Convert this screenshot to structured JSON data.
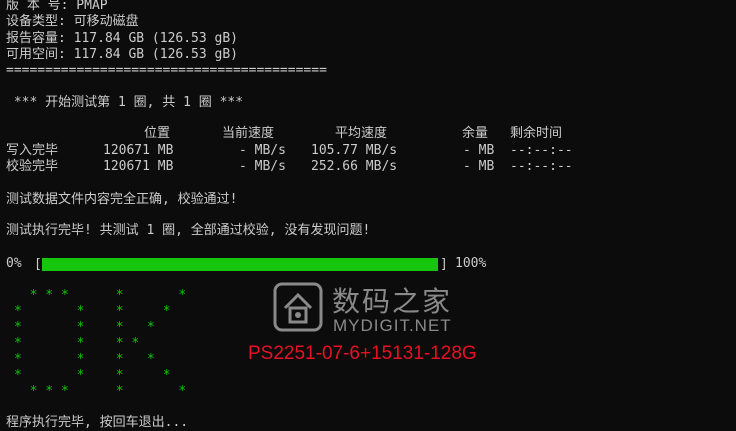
{
  "info": {
    "version_line": "版 本 号: PMAP",
    "device_type_line": "设备类型: 可移动磁盘",
    "reported_capacity_line": "报告容量: 117.84 GB (126.53 gB)",
    "available_space_line": "可用空间: 117.84 GB (126.53 gB)",
    "separator": "========================================="
  },
  "test": {
    "round_header": " *** 开始测试第 1 圈, 共 1 圈 ***"
  },
  "table": {
    "columns": [
      "位置",
      "当前速度",
      "平均速度",
      "余量",
      "剩余时间"
    ],
    "rows": [
      {
        "label": "写入完毕",
        "position": "120671 MB",
        "current": "- MB/s",
        "average": "105.77 MB/s",
        "remaining": "- MB",
        "time_left": "--:--:--"
      },
      {
        "label": "校验完毕",
        "position": "120671 MB",
        "current": "- MB/s",
        "average": "252.66 MB/s",
        "remaining": "- MB",
        "time_left": "--:--:--"
      }
    ]
  },
  "messages": {
    "verify_ok": "测试数据文件内容完全正确, 校验通过!",
    "done": "测试执行完毕! 共测试 1 圈, 全部通过校验, 没有发现问题!",
    "exit_prompt": "程序执行完毕, 按回车退出..."
  },
  "progress": {
    "start_label": "0%",
    "end_label": "100%",
    "left_bracket": "[",
    "right_bracket": "]",
    "value": 1.0,
    "color": "#16c60c"
  },
  "ok_art": [
    "  * * *      *       *",
    "*       *    *     *  ",
    "*       *    *   *    ",
    "*       *    * *      ",
    "*       *    *   *    ",
    "*       *    *     *  ",
    "  * * *      *       *"
  ],
  "watermark": {
    "name": "数码之家",
    "site": "MYDIGIT.NET",
    "part_number": "PS2251-07-6+15131-128G",
    "part_color": "#e81123"
  },
  "colors": {
    "background": "#0c0c0c",
    "text": "#cccccc",
    "accent_green": "#16c60c"
  }
}
